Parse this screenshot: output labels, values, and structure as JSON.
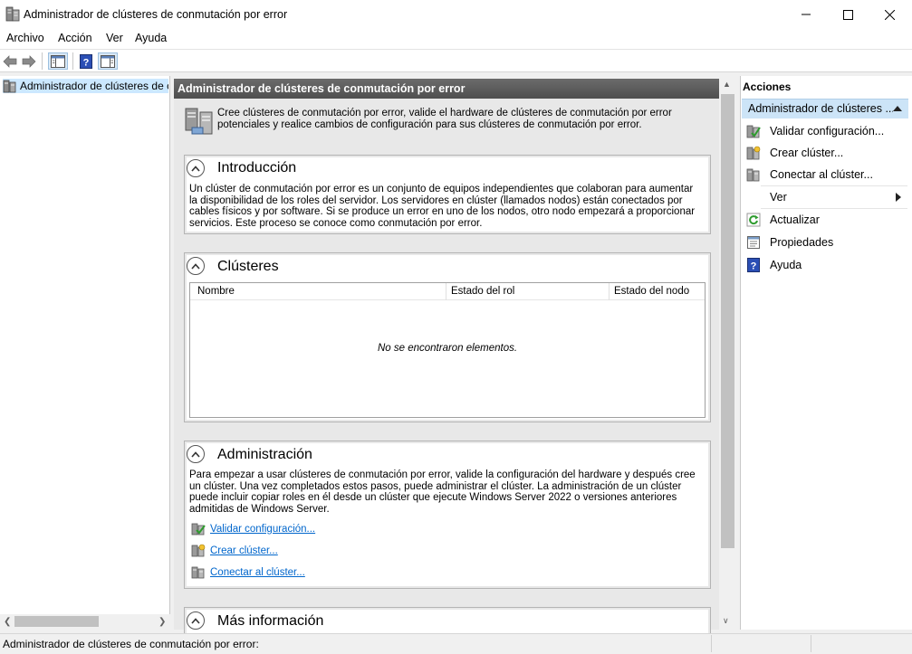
{
  "window": {
    "title": "Administrador de clústeres de conmutación por error",
    "controls": [
      "minimize-icon",
      "maximize-icon",
      "close-icon"
    ]
  },
  "menu": [
    "Archivo",
    "Acción",
    "Ver",
    "Ayuda"
  ],
  "toolbar": {
    "buttons": [
      "back-arrow-icon",
      "forward-arrow-icon",
      "show-hide-tree-icon",
      "help-icon",
      "show-hide-action-pane-icon"
    ]
  },
  "tree": {
    "items": [
      {
        "label": "Administrador de clústeres de conmutación por error",
        "selected": true
      }
    ]
  },
  "center": {
    "header": "Administrador de clústeres de conmutación por error",
    "intro": "Cree clústeres de conmutación por error, valide el hardware de clústeres de conmutación por error potenciales y realice cambios de configuración para sus clústeres de conmutación por error.",
    "sections": {
      "introduccion": {
        "title": "Introducción",
        "text": "Un clúster de conmutación por error es un conjunto de equipos independientes que colaboran para aumentar la disponibilidad de los roles del servidor. Los servidores en clúster (llamados nodos) están conectados por cables físicos y por software. Si se produce un error en uno de los nodos, otro nodo empezará a proporcionar servicios. Este proceso se conoce como conmutación por error."
      },
      "clusteres": {
        "title": "Clústeres",
        "columns": [
          "Nombre",
          "Estado del rol",
          "Estado del nodo"
        ],
        "rows": [],
        "empty_message": "No se encontraron elementos."
      },
      "administracion": {
        "title": "Administración",
        "text": "Para empezar a usar clústeres de conmutación por error, valide la configuración del hardware y después cree un clúster. Una vez completados estos pasos, puede administrar el clúster. La administración de un clúster puede incluir copiar roles en él desde un clúster que ejecute Windows Server 2022 o versiones anteriores admitidas de Windows Server.",
        "links": [
          "Validar configuración...",
          "Crear clúster...",
          "Conectar al clúster..."
        ]
      },
      "mas_informacion": {
        "title": "Más información"
      }
    }
  },
  "actions": {
    "header": "Acciones",
    "group": "Administrador de clústeres ...",
    "items": [
      {
        "label": "Validar configuración...",
        "icon": "validate-cluster-icon"
      },
      {
        "label": "Crear clúster...",
        "icon": "create-cluster-icon"
      },
      {
        "label": "Conectar al clúster...",
        "icon": "connect-cluster-icon"
      },
      {
        "label": "Ver",
        "icon": "",
        "submenu": true
      },
      {
        "label": "Actualizar",
        "icon": "refresh-icon"
      },
      {
        "label": "Propiedades",
        "icon": "properties-icon"
      },
      {
        "label": "Ayuda",
        "icon": "help-icon"
      }
    ]
  },
  "status": {
    "text": "Administrador de clústeres de conmutación por error:"
  },
  "colors": {
    "selection": "#cce8ff",
    "action_group": "#cce4f7",
    "link": "#0066cc",
    "header_bar": "#5a5a5a",
    "help_blue": "#2b4fb5"
  }
}
